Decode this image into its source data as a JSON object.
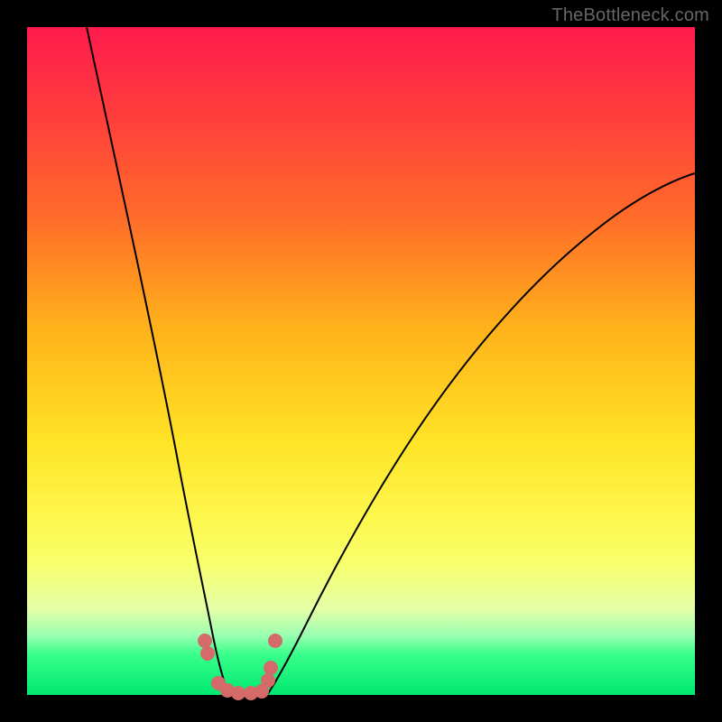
{
  "watermark": "TheBottleneck.com",
  "chart_data": {
    "type": "line",
    "title": "",
    "xlabel": "",
    "ylabel": "",
    "xlim": [
      0,
      100
    ],
    "ylim": [
      0,
      100
    ],
    "grid": false,
    "legend_position": "none",
    "series": [
      {
        "name": "curve-left",
        "x": [
          9,
          12,
          15,
          18,
          20,
          22,
          24,
          26,
          28,
          29
        ],
        "values": [
          100,
          79,
          60,
          45,
          35,
          25,
          15,
          7,
          2,
          0
        ]
      },
      {
        "name": "curve-right",
        "x": [
          36,
          38,
          41,
          45,
          50,
          56,
          63,
          71,
          80,
          90,
          100
        ],
        "values": [
          0,
          3,
          8,
          15,
          24,
          34,
          45,
          55,
          64,
          72,
          78
        ]
      },
      {
        "name": "bottom-markers",
        "x": [
          26.5,
          26.8,
          28.5,
          30,
          31.5,
          33.5,
          35,
          36,
          36.3,
          37
        ],
        "values": [
          8,
          6,
          1.5,
          0.5,
          0.3,
          0.3,
          0.5,
          2,
          4,
          8
        ]
      }
    ],
    "annotations": []
  },
  "colors": {
    "background_black": "#000000",
    "gradient_top": "#ff1a4d",
    "gradient_bottom": "#00e86f",
    "curve": "#000000",
    "marker": "#d46a6a",
    "watermark": "#666666"
  }
}
